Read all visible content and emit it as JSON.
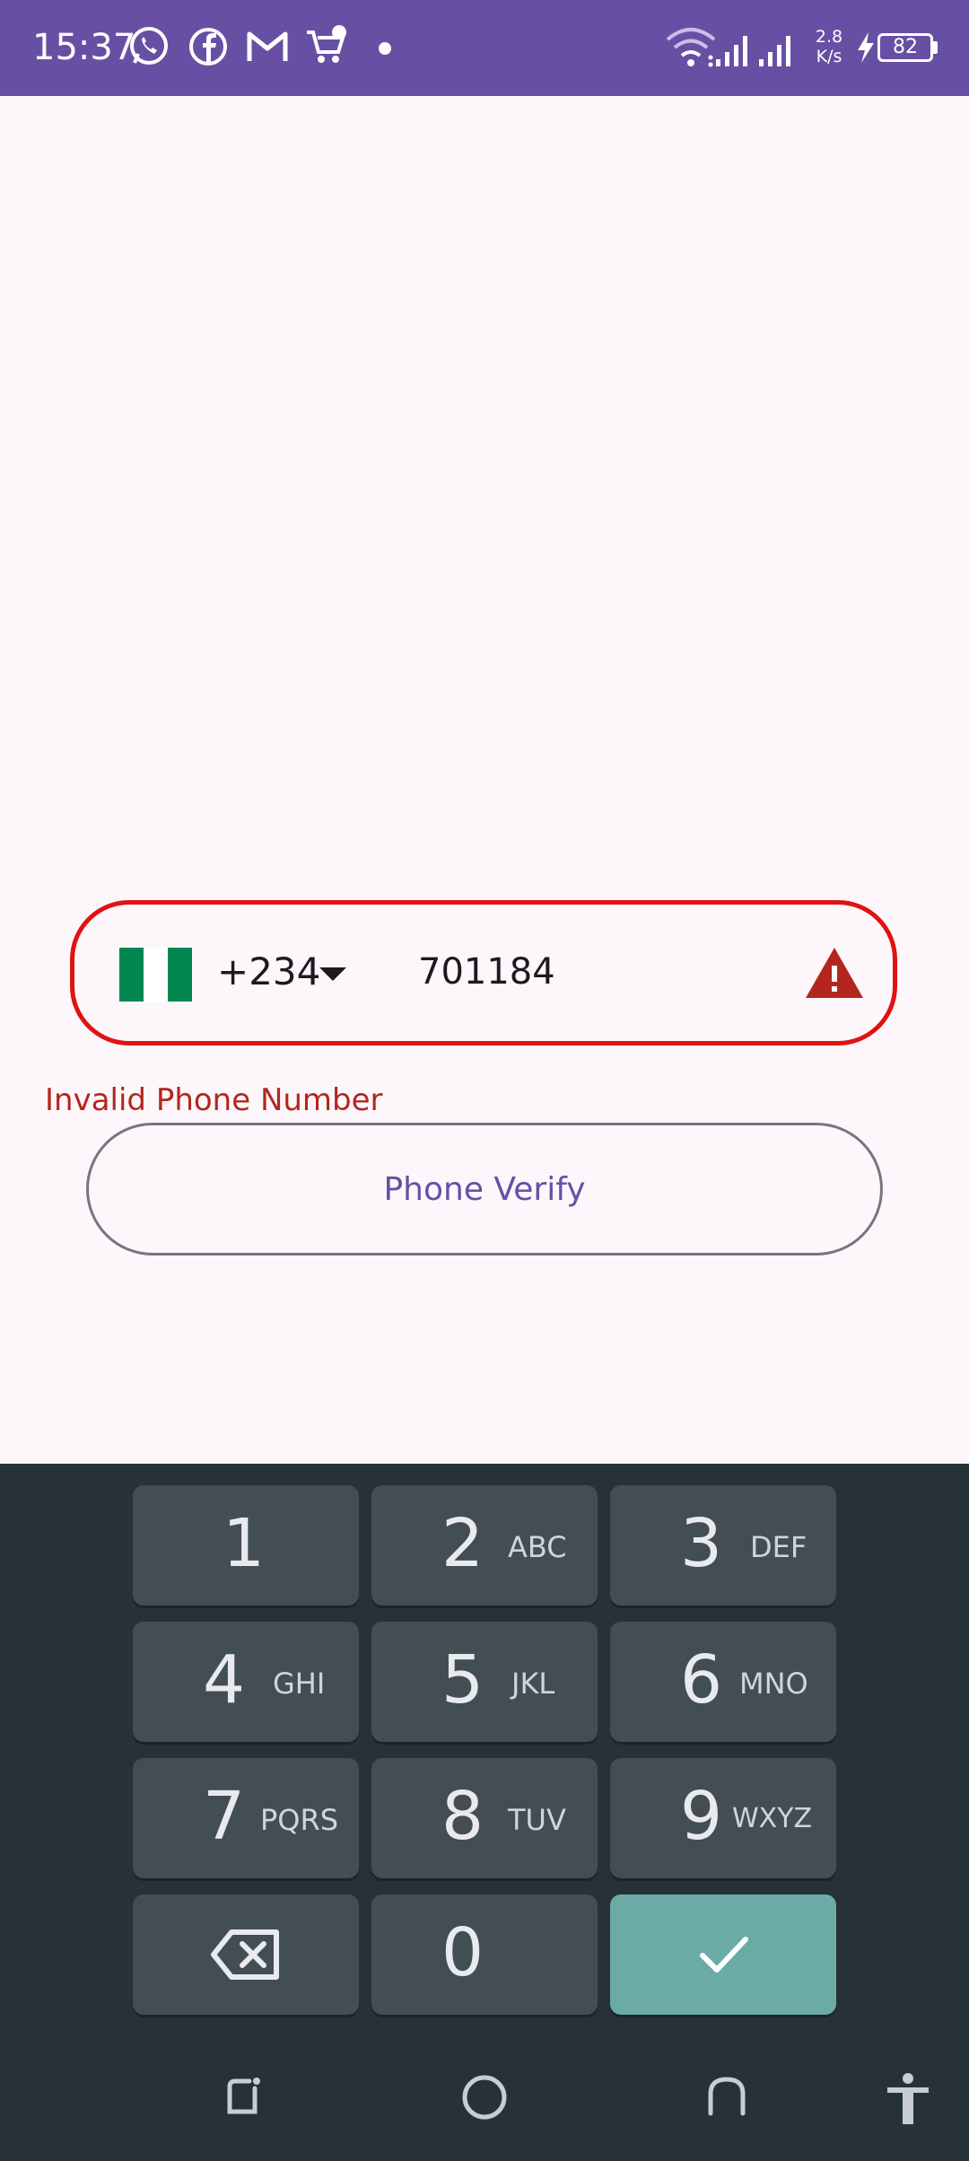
{
  "status_bar": {
    "time": "15:37",
    "net_speed_value": "2.8",
    "net_speed_unit": "K/s",
    "battery": "82",
    "notification_icons": [
      "whatsapp-icon",
      "facebook-icon",
      "gmail-icon",
      "shopping-cart-icon"
    ]
  },
  "phone_input": {
    "country_flag": "nigeria-flag",
    "dial_code": "+234",
    "value": "701184",
    "error_message": "Invalid Phone Number"
  },
  "verify_button": {
    "label": "Phone Verify"
  },
  "keypad": {
    "keys": [
      {
        "digit": "1",
        "letters": ""
      },
      {
        "digit": "2",
        "letters": "ABC"
      },
      {
        "digit": "3",
        "letters": "DEF"
      },
      {
        "digit": "4",
        "letters": "GHI"
      },
      {
        "digit": "5",
        "letters": "JKL"
      },
      {
        "digit": "6",
        "letters": "MNO"
      },
      {
        "digit": "7",
        "letters": "PQRS"
      },
      {
        "digit": "8",
        "letters": "TUV"
      },
      {
        "digit": "9",
        "letters": "WXYZ"
      },
      {
        "digit": "0",
        "letters": ""
      }
    ]
  },
  "colors": {
    "status_bar": "#6750a4",
    "error": "#e01313",
    "keypad_bg": "#263238",
    "key_bg": "#434d54",
    "done_key": "#6aaca5",
    "flag_green": "#008751"
  }
}
